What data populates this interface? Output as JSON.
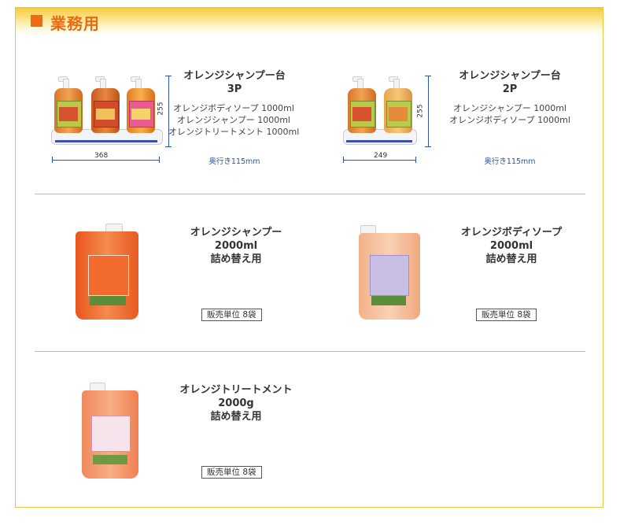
{
  "section": {
    "title": "業務用"
  },
  "row1": {
    "left": {
      "name_line1": "オレンジシャンプー台",
      "name_line2": "3P",
      "items": [
        "オレンジボディソープ 1000ml",
        "オレンジシャンプー 1000ml",
        "オレンジトリートメント 1000ml"
      ],
      "depth": "奥行き115mm",
      "height_label": "255",
      "width_label": "368"
    },
    "right": {
      "name_line1": "オレンジシャンプー台",
      "name_line2": "2P",
      "items": [
        "オレンジシャンプー 1000ml",
        "オレンジボディソープ 1000ml"
      ],
      "depth": "奥行き115mm",
      "height_label": "255",
      "width_label": "249"
    }
  },
  "row2": {
    "left": {
      "name": "オレンジシャンプー",
      "size": "2000ml",
      "type": "詰め替え用",
      "unit": "販売単位 8袋"
    },
    "right": {
      "name": "オレンジボディソープ",
      "size": "2000ml",
      "type": "詰め替え用",
      "unit": "販売単位 8袋"
    }
  },
  "row3": {
    "left": {
      "name": "オレンジトリートメント",
      "size": "2000g",
      "type": "詰め替え用",
      "unit": "販売単位 8袋"
    }
  },
  "colors": {
    "accent": "#ec6a12",
    "frame": "#e8c640",
    "dimension": "#2b55a6"
  },
  "icons": {
    "header_marker": "orange-square"
  }
}
